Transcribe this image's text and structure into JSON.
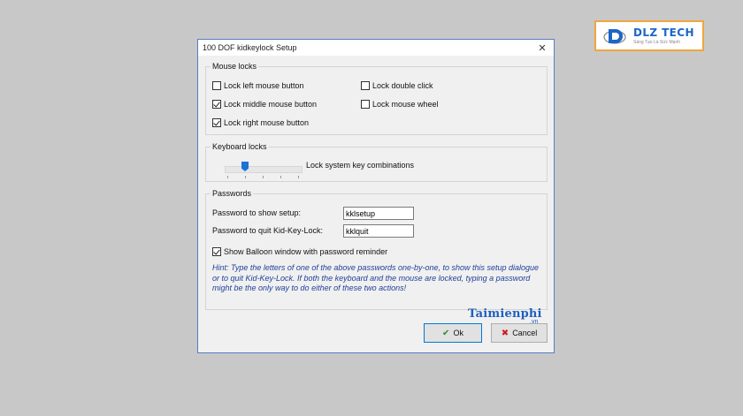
{
  "logo": {
    "brand": "DLZ TECH",
    "tagline": "Sáng Tạo Là Sức Mạnh"
  },
  "window": {
    "title": "100 DOF kidkeylock Setup",
    "close_glyph": "✕"
  },
  "mouse_locks": {
    "legend": "Mouse locks",
    "options": [
      {
        "label": "Lock left mouse button",
        "checked": false
      },
      {
        "label": "Lock middle mouse button",
        "checked": true
      },
      {
        "label": "Lock right mouse button",
        "checked": true
      },
      {
        "label": "Lock double click",
        "checked": false
      },
      {
        "label": "Lock mouse wheel",
        "checked": false
      }
    ]
  },
  "keyboard_locks": {
    "legend": "Keyboard locks",
    "slider_level_fraction": 0.25,
    "slider_label": "Lock system key combinations"
  },
  "passwords": {
    "legend": "Passwords",
    "show_setup_label": "Password to show setup:",
    "show_setup_value": "kklsetup",
    "quit_label": "Password to quit Kid-Key-Lock:",
    "quit_value": "kklquit",
    "balloon": {
      "label": "Show Balloon window with password reminder",
      "checked": true
    },
    "hint": "Hint: Type the letters of one of the above passwords one-by-one, to show this setup dialogue or to quit Kid-Key-Lock. If both the keyboard and the mouse are locked, typing a password might be the only way to do either of these two actions!"
  },
  "watermark": {
    "main": "Taimienphi",
    "sub": ".vn"
  },
  "buttons": {
    "ok": "Ok",
    "cancel": "Cancel"
  },
  "colors": {
    "hint": "#1f3f9a",
    "accent": "#1a73d9",
    "ok_icon": "#2f8b2f",
    "cancel_icon": "#d11b1b"
  }
}
